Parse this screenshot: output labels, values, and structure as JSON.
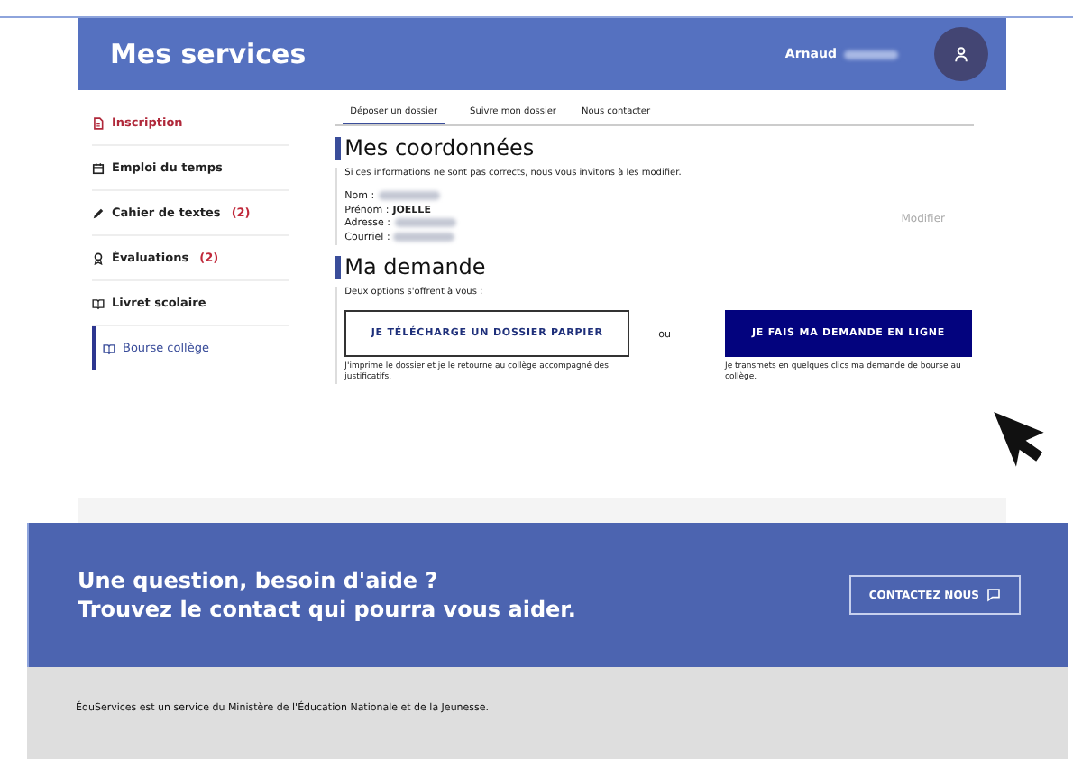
{
  "header": {
    "title": "Mes services",
    "user_name": "Arnaud"
  },
  "sidebar": {
    "items": [
      {
        "label": "Inscription",
        "alert": true,
        "selected": false
      },
      {
        "label": "Emploi du temps",
        "alert": false,
        "selected": false
      },
      {
        "label": "Cahier de textes",
        "count": "(2)",
        "alert": false,
        "selected": false
      },
      {
        "label": "Évaluations",
        "count": "(2)",
        "alert": false,
        "selected": false
      },
      {
        "label": "Livret scolaire",
        "alert": false,
        "selected": false
      },
      {
        "label": "Bourse collège",
        "alert": false,
        "selected": true
      }
    ]
  },
  "tabs": [
    {
      "label": "Déposer un dossier",
      "selected": true
    },
    {
      "label": "Suivre mon dossier",
      "selected": false
    },
    {
      "label": "Nous contacter",
      "selected": false
    }
  ],
  "coordonnees": {
    "title": "Mes coordonnées",
    "intro": "Si ces informations ne sont pas corrects, nous vous invitons à les modifier.",
    "fields": [
      {
        "label": "Nom :",
        "blurred": true
      },
      {
        "label": "Prénom :",
        "value": "JOELLE",
        "blurred": false
      },
      {
        "label": "Adresse :",
        "blurred": true
      },
      {
        "label": "Courriel :",
        "blurred": true
      }
    ],
    "edit_link": "Modifier"
  },
  "demande": {
    "title": "Ma demande",
    "intro": "Deux options s'offrent à vous :",
    "separator": "ou",
    "options": [
      {
        "kind": "outline",
        "button": "JE TÉLÉCHARGE UN DOSSIER PARPIER",
        "note": "J'imprime le dossier et je le retourne au collège accompagné des justificatifs."
      },
      {
        "kind": "filled",
        "button": "JE FAIS MA DEMANDE EN LIGNE",
        "note": "Je transmets en quelques clics ma demande de bourse au collège."
      }
    ]
  },
  "help": {
    "lines": [
      "Une question, besoin d'aide ?",
      "Trouvez le contact qui pourra vous aider."
    ],
    "button": "CONTACTEZ NOUS"
  },
  "footer": {
    "text": "ÉduServices est un service du Ministère de l'Éducation Nationale et de la Jeunesse."
  }
}
